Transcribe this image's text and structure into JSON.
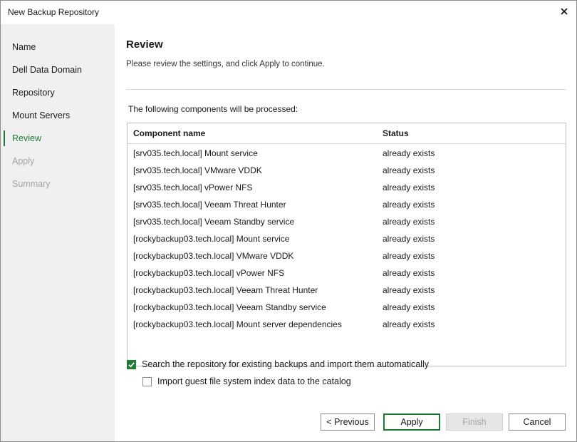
{
  "window": {
    "title": "New Backup Repository"
  },
  "sidebar": {
    "steps": [
      {
        "label": "Name",
        "state": "normal"
      },
      {
        "label": "Dell Data Domain",
        "state": "normal"
      },
      {
        "label": "Repository",
        "state": "normal"
      },
      {
        "label": "Mount Servers",
        "state": "normal"
      },
      {
        "label": "Review",
        "state": "active"
      },
      {
        "label": "Apply",
        "state": "disabled"
      },
      {
        "label": "Summary",
        "state": "disabled"
      }
    ]
  },
  "main": {
    "heading": "Review",
    "subheading": "Please review the settings, and click Apply to continue.",
    "table_caption": "The following components will be processed:",
    "table": {
      "headers": [
        "Component name",
        "Status"
      ],
      "rows": [
        [
          "[srv035.tech.local] Mount service",
          "already exists"
        ],
        [
          "[srv035.tech.local] VMware VDDK",
          "already exists"
        ],
        [
          "[srv035.tech.local] vPower NFS",
          "already exists"
        ],
        [
          "[srv035.tech.local] Veeam Threat Hunter",
          "already exists"
        ],
        [
          "[srv035.tech.local] Veeam Standby service",
          "already exists"
        ],
        [
          "[rockybackup03.tech.local] Mount service",
          "already exists"
        ],
        [
          "[rockybackup03.tech.local] VMware VDDK",
          "already exists"
        ],
        [
          "[rockybackup03.tech.local] vPower NFS",
          "already exists"
        ],
        [
          "[rockybackup03.tech.local] Veeam Threat Hunter",
          "already exists"
        ],
        [
          "[rockybackup03.tech.local] Veeam Standby service",
          "already exists"
        ],
        [
          "[rockybackup03.tech.local] Mount server dependencies",
          "already exists"
        ]
      ]
    },
    "options": {
      "search_existing": {
        "label": "Search the repository for existing backups and import them automatically",
        "checked": true
      },
      "import_index": {
        "label": "Import guest file system index data to the catalog",
        "checked": false
      }
    }
  },
  "buttons": {
    "previous": "< Previous",
    "apply": "Apply",
    "finish": "Finish",
    "cancel": "Cancel"
  },
  "colors": {
    "accent": "#1f7a34",
    "sidebar_bg": "#f0f0f0",
    "disabled_text": "#a3a3a3"
  },
  "icons": {
    "close": "close-icon",
    "check": "checkmark-icon"
  }
}
